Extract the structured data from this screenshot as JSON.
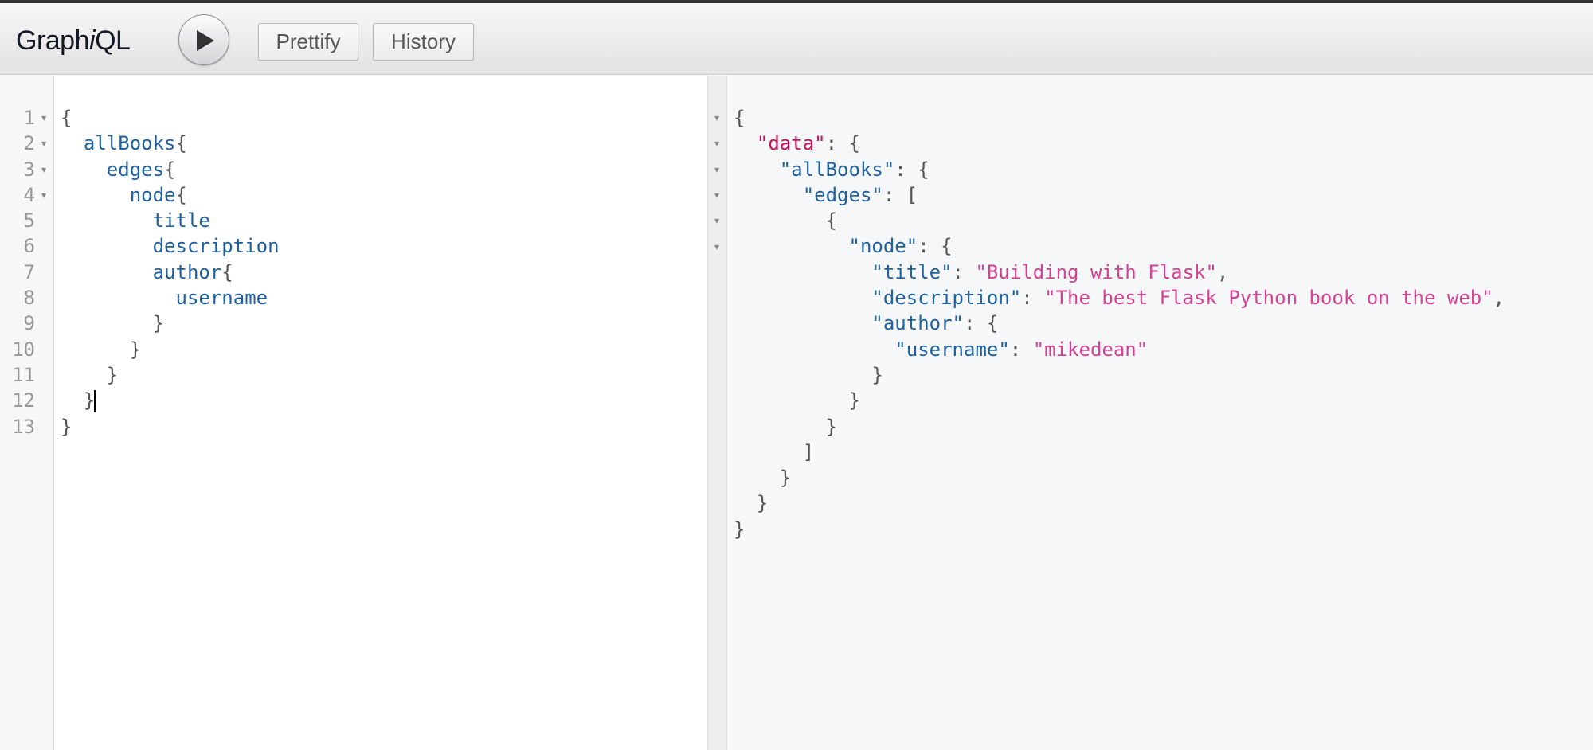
{
  "app": {
    "logo_prefix": "Graph",
    "logo_italic": "i",
    "logo_suffix": "QL"
  },
  "toolbar": {
    "run_icon": "play-icon",
    "prettify_label": "Prettify",
    "history_label": "History"
  },
  "query_editor": {
    "line_numbers": [
      "1",
      "2",
      "3",
      "4",
      "5",
      "6",
      "7",
      "8",
      "9",
      "10",
      "11",
      "12",
      "13"
    ],
    "foldable_lines": [
      1,
      2,
      3,
      4
    ],
    "lines": [
      {
        "indent": "",
        "text": "{",
        "kind": "punct"
      },
      {
        "indent": "  ",
        "field": "allBooks",
        "punct": "{"
      },
      {
        "indent": "    ",
        "field": "edges",
        "punct": "{"
      },
      {
        "indent": "      ",
        "field": "node",
        "punct": "{"
      },
      {
        "indent": "        ",
        "field": "title"
      },
      {
        "indent": "        ",
        "field": "description"
      },
      {
        "indent": "        ",
        "field": "author",
        "punct": "{"
      },
      {
        "indent": "          ",
        "field": "username"
      },
      {
        "indent": "        ",
        "text": "}",
        "kind": "punct"
      },
      {
        "indent": "      ",
        "text": "}",
        "kind": "punct"
      },
      {
        "indent": "    ",
        "text": "}",
        "kind": "punct"
      },
      {
        "indent": "  ",
        "text": "}",
        "kind": "punct",
        "cursor": true
      },
      {
        "indent": "",
        "text": "}",
        "kind": "punct"
      }
    ]
  },
  "result_viewer": {
    "foldable_lines": [
      1,
      2,
      3,
      4,
      5,
      6
    ],
    "lines": [
      {
        "indent": "",
        "parts": [
          [
            "punct",
            "{"
          ]
        ]
      },
      {
        "indent": "  ",
        "parts": [
          [
            "key-data",
            "\"data\""
          ],
          [
            "punct",
            ": {"
          ]
        ]
      },
      {
        "indent": "    ",
        "parts": [
          [
            "key",
            "\"allBooks\""
          ],
          [
            "punct",
            ": {"
          ]
        ]
      },
      {
        "indent": "      ",
        "parts": [
          [
            "key",
            "\"edges\""
          ],
          [
            "punct",
            ": ["
          ]
        ]
      },
      {
        "indent": "        ",
        "parts": [
          [
            "punct",
            "{"
          ]
        ]
      },
      {
        "indent": "          ",
        "parts": [
          [
            "key",
            "\"node\""
          ],
          [
            "punct",
            ": {"
          ]
        ]
      },
      {
        "indent": "            ",
        "parts": [
          [
            "key",
            "\"title\""
          ],
          [
            "punct",
            ": "
          ],
          [
            "str",
            "\"Building with Flask\""
          ],
          [
            "punct",
            ","
          ]
        ]
      },
      {
        "indent": "            ",
        "parts": [
          [
            "key",
            "\"description\""
          ],
          [
            "punct",
            ": "
          ],
          [
            "str",
            "\"The best Flask Python book on the web\""
          ],
          [
            "punct",
            ","
          ]
        ]
      },
      {
        "indent": "            ",
        "parts": [
          [
            "key",
            "\"author\""
          ],
          [
            "punct",
            ": {"
          ]
        ]
      },
      {
        "indent": "              ",
        "parts": [
          [
            "key",
            "\"username\""
          ],
          [
            "punct",
            ": "
          ],
          [
            "str",
            "\"mikedean\""
          ]
        ]
      },
      {
        "indent": "            ",
        "parts": [
          [
            "punct",
            "}"
          ]
        ]
      },
      {
        "indent": "          ",
        "parts": [
          [
            "punct",
            "}"
          ]
        ]
      },
      {
        "indent": "        ",
        "parts": [
          [
            "punct",
            "}"
          ]
        ]
      },
      {
        "indent": "      ",
        "parts": [
          [
            "punct",
            "]"
          ]
        ]
      },
      {
        "indent": "    ",
        "parts": [
          [
            "punct",
            "}"
          ]
        ]
      },
      {
        "indent": "  ",
        "parts": [
          [
            "punct",
            "}"
          ]
        ]
      },
      {
        "indent": "",
        "parts": [
          [
            "punct",
            "}"
          ]
        ]
      }
    ]
  }
}
